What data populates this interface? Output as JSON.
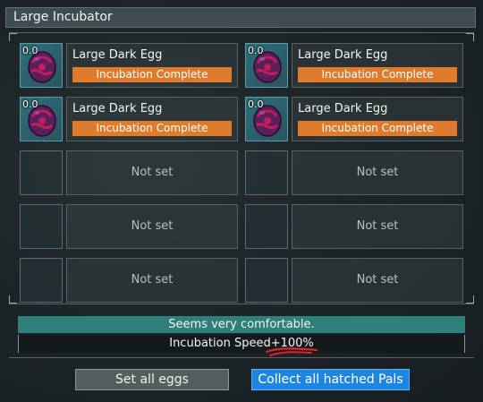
{
  "window": {
    "title": "Large Incubator"
  },
  "slots": [
    {
      "filled": true,
      "speed": "0.0",
      "name": "Large Dark Egg",
      "status": "Incubation Complete"
    },
    {
      "filled": true,
      "speed": "0.0",
      "name": "Large Dark Egg",
      "status": "Incubation Complete"
    },
    {
      "filled": true,
      "speed": "0.0",
      "name": "Large Dark Egg",
      "status": "Incubation Complete"
    },
    {
      "filled": true,
      "speed": "0.0",
      "name": "Large Dark Egg",
      "status": "Incubation Complete"
    },
    {
      "filled": false,
      "empty_label": "Not set"
    },
    {
      "filled": false,
      "empty_label": "Not set"
    },
    {
      "filled": false,
      "empty_label": "Not set"
    },
    {
      "filled": false,
      "empty_label": "Not set"
    },
    {
      "filled": false,
      "empty_label": "Not set"
    },
    {
      "filled": false,
      "empty_label": "Not set"
    }
  ],
  "comfort": {
    "text": "Seems very comfortable."
  },
  "speed": {
    "text": "Incubation Speed+100%"
  },
  "buttons": {
    "set_all": "Set all eggs",
    "collect_all": "Collect all hatched Pals"
  },
  "colors": {
    "status_orange": "#e07a2c",
    "comfort_teal": "#2f7f7b",
    "collect_blue": "#1f86e0",
    "egg_purple": "#5a1f5e",
    "egg_spots": "#c21e5a"
  },
  "icons": {
    "egg": "dark-egg-icon"
  }
}
